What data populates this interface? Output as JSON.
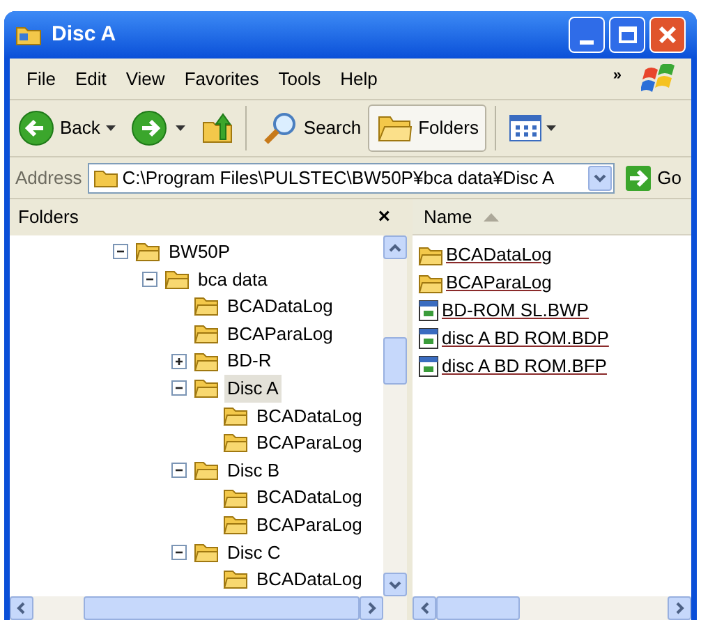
{
  "window": {
    "title": "Disc A"
  },
  "menu": [
    "File",
    "Edit",
    "View",
    "Favorites",
    "Tools",
    "Help"
  ],
  "menu_chevron": "»",
  "toolbar": {
    "back": "Back",
    "search": "Search",
    "folders": {
      "label": "Folders",
      "selected": true
    }
  },
  "address": {
    "label": "Address",
    "value": "C:\\Program Files\\PULSTEC\\BW50P¥bca data¥Disc A",
    "go": "Go"
  },
  "folders_pane": {
    "title": "Folders",
    "close": "×",
    "tree": [
      {
        "label": "BW50P",
        "expanded": true,
        "selected": false,
        "children": [
          {
            "label": "bca data",
            "expanded": true,
            "selected": false,
            "children": [
              {
                "label": "BCADataLog",
                "selected": false
              },
              {
                "label": "BCAParaLog",
                "selected": false
              },
              {
                "label": "BD-R",
                "expanded": false,
                "selected": false
              },
              {
                "label": "Disc A",
                "expanded": true,
                "selected": true,
                "children": [
                  {
                    "label": "BCADataLog",
                    "selected": false
                  },
                  {
                    "label": "BCAParaLog",
                    "selected": false
                  }
                ]
              },
              {
                "label": "Disc B",
                "expanded": true,
                "selected": false,
                "children": [
                  {
                    "label": "BCADataLog",
                    "selected": false
                  },
                  {
                    "label": "BCAParaLog",
                    "selected": false
                  }
                ]
              },
              {
                "label": "Disc C",
                "expanded": true,
                "selected": false,
                "children": [
                  {
                    "label": "BCADataLog",
                    "selected": false
                  }
                ]
              }
            ]
          }
        ]
      }
    ]
  },
  "files_pane": {
    "column": "Name",
    "items": [
      {
        "name": "BCADataLog",
        "kind": "folder"
      },
      {
        "name": "BCAParaLog",
        "kind": "folder"
      },
      {
        "name": "BD-ROM SL.BWP",
        "kind": "file"
      },
      {
        "name": "disc A BD ROM.BDP",
        "kind": "file"
      },
      {
        "name": "disc A BD ROM.BFP",
        "kind": "file"
      }
    ]
  }
}
